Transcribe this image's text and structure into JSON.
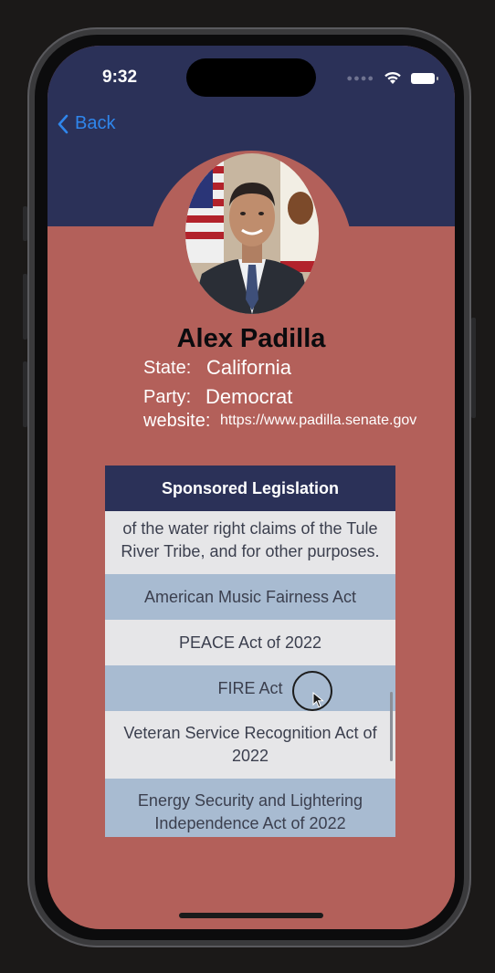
{
  "status_bar": {
    "time": "9:32"
  },
  "nav": {
    "back_label": "Back"
  },
  "profile": {
    "name": "Alex Padilla",
    "state_label": "State:",
    "state_value": "California",
    "party_label": "Party:",
    "party_value": "Democrat",
    "website_label": "website:",
    "website_value": "https://www.padilla.senate.gov"
  },
  "legislation": {
    "header": "Sponsored Legislation",
    "items": [
      {
        "title": "of the water right claims of the Tule River Tribe, and for other purposes.",
        "style": "light"
      },
      {
        "title": "American Music Fairness Act",
        "style": "blue"
      },
      {
        "title": "PEACE Act of 2022",
        "style": "light"
      },
      {
        "title": "FIRE Act",
        "style": "blue"
      },
      {
        "title": "Veteran Service Recognition Act of 2022",
        "style": "light"
      },
      {
        "title": "Energy Security and Lightering Independence Act of 2022",
        "style": "blue"
      }
    ]
  },
  "colors": {
    "navy": "#2b3158",
    "rose": "#b3605a",
    "link_blue": "#2f86ec",
    "row_light": "#e6e6e8",
    "row_blue": "#a8bbd1"
  }
}
